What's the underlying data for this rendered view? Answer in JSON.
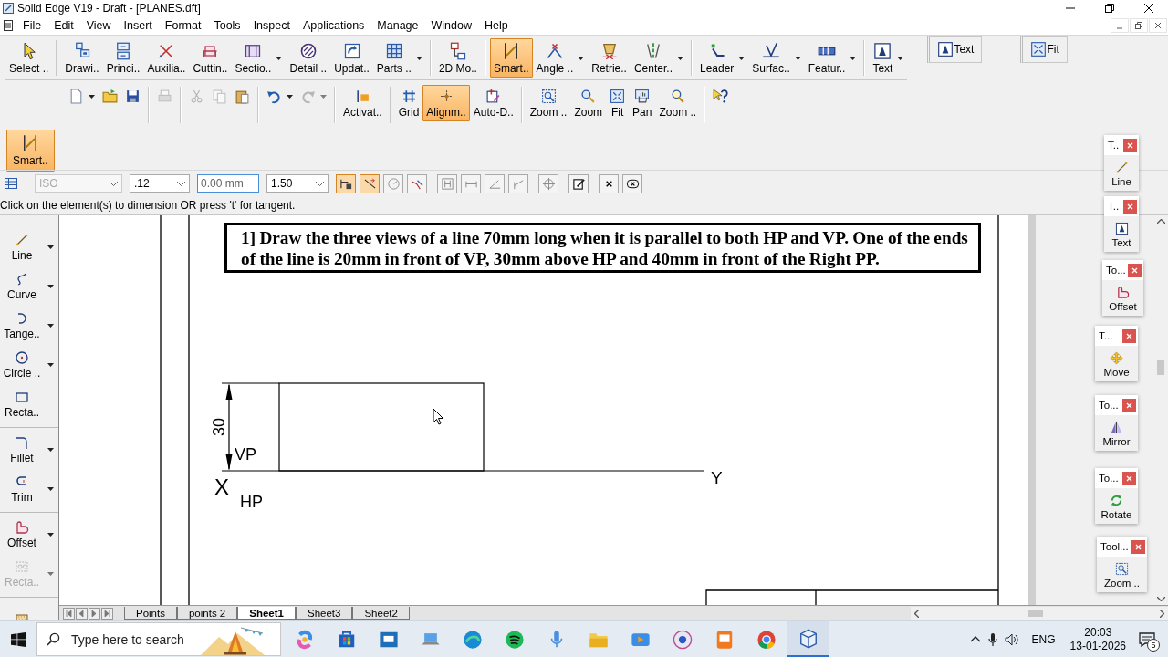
{
  "window": {
    "title": "Solid Edge V19 - Draft - [PLANES.dft]"
  },
  "menu": [
    "File",
    "Edit",
    "View",
    "Insert",
    "Format",
    "Tools",
    "Inspect",
    "Applications",
    "Manage",
    "Window",
    "Help"
  ],
  "draw_toolbar": {
    "groups": [
      [
        {
          "label": "Select ..",
          "selected": false,
          "dropdown": false
        }
      ],
      [
        {
          "label": "Drawi..",
          "selected": false,
          "dropdown": false
        },
        {
          "label": "Princi..",
          "selected": false,
          "dropdown": false
        },
        {
          "label": "Auxilia..",
          "selected": false,
          "dropdown": false
        },
        {
          "label": "Cuttin..",
          "selected": false,
          "dropdown": false
        },
        {
          "label": "Sectio..",
          "selected": false,
          "dropdown": true
        },
        {
          "label": "Detail ..",
          "selected": false,
          "dropdown": false
        },
        {
          "label": "Updat..",
          "selected": false,
          "dropdown": false
        },
        {
          "label": "Parts ..",
          "selected": false,
          "dropdown": true
        }
      ],
      [
        {
          "label": "2D Mo..",
          "selected": false,
          "dropdown": false
        }
      ],
      [
        {
          "label": "Smart..",
          "selected": true,
          "dropdown": false
        },
        {
          "label": "Angle ..",
          "selected": false,
          "dropdown": true
        },
        {
          "label": "Retrie..",
          "selected": false,
          "dropdown": false
        },
        {
          "label": "Center..",
          "selected": false,
          "dropdown": true
        }
      ],
      [
        {
          "label": "Leader",
          "selected": false,
          "dropdown": true
        },
        {
          "label": "Surfac..",
          "selected": false,
          "dropdown": true
        },
        {
          "label": "Featur..",
          "selected": false,
          "dropdown": true
        }
      ],
      [
        {
          "label": "Text",
          "selected": false,
          "dropdown": true
        }
      ]
    ]
  },
  "floating_toolbars": [
    {
      "label": "Text"
    },
    {
      "label": "Fit"
    }
  ],
  "main_toolbar": {
    "groups": [
      [
        {
          "selected": false,
          "disabled": false,
          "dropdown": true
        },
        {
          "selected": false,
          "disabled": false,
          "dropdown": false
        },
        {
          "selected": false,
          "disabled": false,
          "dropdown": false
        }
      ],
      [
        {
          "selected": false,
          "disabled": true,
          "dropdown": false
        }
      ],
      [
        {
          "selected": false,
          "disabled": true,
          "dropdown": false
        },
        {
          "selected": false,
          "disabled": true,
          "dropdown": false
        },
        {
          "selected": false,
          "disabled": false,
          "dropdown": false
        }
      ],
      [
        {
          "selected": false,
          "disabled": false,
          "dropdown": true
        },
        {
          "selected": false,
          "disabled": true,
          "dropdown": true
        }
      ],
      [
        {
          "label": "Activat..",
          "selected": false,
          "disabled": false,
          "dropdown": false
        }
      ],
      [
        {
          "label": "Grid",
          "selected": false,
          "disabled": false,
          "dropdown": false
        },
        {
          "label": "Alignm..",
          "selected": true,
          "disabled": false,
          "dropdown": false
        },
        {
          "label": "Auto-D..",
          "selected": false,
          "disabled": false,
          "dropdown": false
        }
      ],
      [
        {
          "label": "Zoom ..",
          "selected": false,
          "disabled": false,
          "dropdown": false
        },
        {
          "label": "Zoom",
          "selected": false,
          "disabled": false,
          "dropdown": false
        },
        {
          "label": "Fit",
          "selected": false,
          "disabled": false,
          "dropdown": false
        },
        {
          "label": "Pan",
          "selected": false,
          "disabled": false,
          "dropdown": false
        },
        {
          "label": "Zoom ..",
          "selected": false,
          "disabled": false,
          "dropdown": false
        }
      ],
      [
        {
          "selected": false,
          "disabled": false,
          "dropdown": false
        }
      ]
    ]
  },
  "command_bar": [
    {
      "label": "Smart..",
      "selected": true
    }
  ],
  "ribbon": {
    "style": {
      "value": "ISO",
      "disabled": true
    },
    "precision": {
      "value": ".12"
    },
    "offset": {
      "value": "0.00 mm"
    },
    "scale": {
      "value": "1.50"
    },
    "toggles": [
      {
        "on": true
      },
      {
        "on": true
      },
      {
        "on": false
      },
      {
        "on": false
      },
      {
        "on": false
      },
      {
        "on": false
      },
      {
        "on": false
      },
      {
        "on": false
      },
      {
        "on": false
      },
      {
        "on": false
      },
      {
        "on": false
      },
      {
        "on": false
      }
    ]
  },
  "prompt": "Click on the element(s) to dimension OR press 't' for tangent.",
  "sidebar": {
    "groups": [
      [
        {
          "label": "Line",
          "dropdown": true,
          "disabled": false
        },
        {
          "label": "Curve",
          "dropdown": true,
          "disabled": false
        },
        {
          "label": "Tange..",
          "dropdown": true,
          "disabled": false
        },
        {
          "label": "Circle ..",
          "dropdown": true,
          "disabled": false
        },
        {
          "label": "Recta..",
          "dropdown": false,
          "disabled": false
        }
      ],
      [
        {
          "label": "Fillet",
          "dropdown": true,
          "disabled": false
        },
        {
          "label": "Trim",
          "dropdown": true,
          "disabled": false
        }
      ],
      [
        {
          "label": "Offset",
          "dropdown": true,
          "disabled": false
        },
        {
          "label": "Recta..",
          "dropdown": true,
          "disabled": true
        }
      ],
      [
        {
          "dropdown": false,
          "disabled": false
        }
      ]
    ]
  },
  "drawing": {
    "problem": "1] Draw the three views of a line 70mm long when it is parallel to both HP and VP. One of the ends of the line is 20mm in front of VP, 30mm above HP and 40mm in front of the Right PP.",
    "dimension": "30",
    "vp_label": "VP",
    "x_label": "X",
    "hp_label": "HP",
    "y_label": "Y"
  },
  "palettes": [
    {
      "title": "T..",
      "tool": "Line"
    },
    {
      "title": "T..",
      "tool": "Text"
    },
    {
      "title": "To...",
      "tool": "Offset"
    },
    {
      "title": "T...",
      "tool": "Move"
    },
    {
      "title": "To...",
      "tool": "Mirror"
    },
    {
      "title": "To...",
      "tool": "Rotate"
    },
    {
      "title": "Tool...",
      "tool": "Zoom .."
    }
  ],
  "sheet_tabs": [
    {
      "label": "Points",
      "selected": false
    },
    {
      "label": "points 2",
      "selected": false
    },
    {
      "label": "Sheet1",
      "selected": true
    },
    {
      "label": "Sheet3",
      "selected": false
    },
    {
      "label": "Sheet2",
      "selected": false
    }
  ],
  "taskbar": {
    "search": {
      "placeholder": "Type here to search"
    },
    "apps": [
      {
        "active": false
      },
      {
        "active": false
      },
      {
        "active": false
      },
      {
        "active": false
      },
      {
        "active": false
      },
      {
        "active": false
      },
      {
        "active": false
      },
      {
        "active": false
      },
      {
        "active": false
      },
      {
        "active": false
      },
      {
        "active": false
      },
      {
        "active": false
      },
      {
        "active": true
      }
    ],
    "tray": {
      "language": "ENG",
      "time": "20:03",
      "date": "13-01-2026",
      "notification_count": "5"
    }
  }
}
